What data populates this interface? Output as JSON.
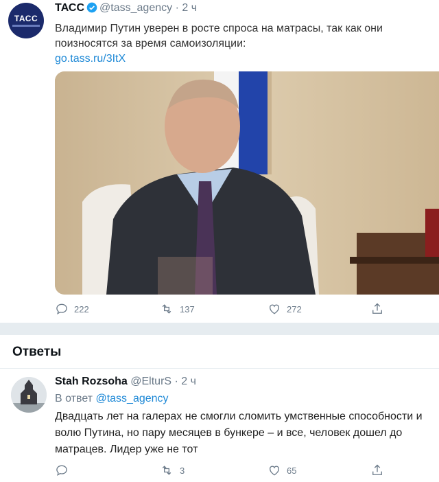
{
  "tweet": {
    "avatar_text": "ТАСС",
    "name": "ТАСС",
    "handle": "@tass_agency",
    "separator": "·",
    "time": "2 ч",
    "text": "Владимир Путин уверен в росте спроса на матрасы, так как они поизносятся за время самоизоляции:",
    "link": "go.tass.ru/3ItX",
    "counts": {
      "replies": "222",
      "retweets": "137",
      "likes": "272"
    }
  },
  "replies_section": {
    "title": "Ответы"
  },
  "reply": {
    "name": "Stah Rozsoha",
    "handle": "@ElturS",
    "separator": "·",
    "time": "2 ч",
    "reply_to_prefix": "В ответ",
    "reply_to_handle": "@tass_agency",
    "text": "Двадцать лет на галерах не смогли сломить умственные способности и волю Путина, но пару месяцев в бункере – и все, человек дошел до матрацев. Лидер уже не тот",
    "counts": {
      "retweets": "3",
      "likes": "65"
    }
  },
  "colors": {
    "link": "#1d88d6",
    "muted": "#6b7a89",
    "verified": "#1da1f2",
    "avatar_bg": "#1b2a6b"
  }
}
